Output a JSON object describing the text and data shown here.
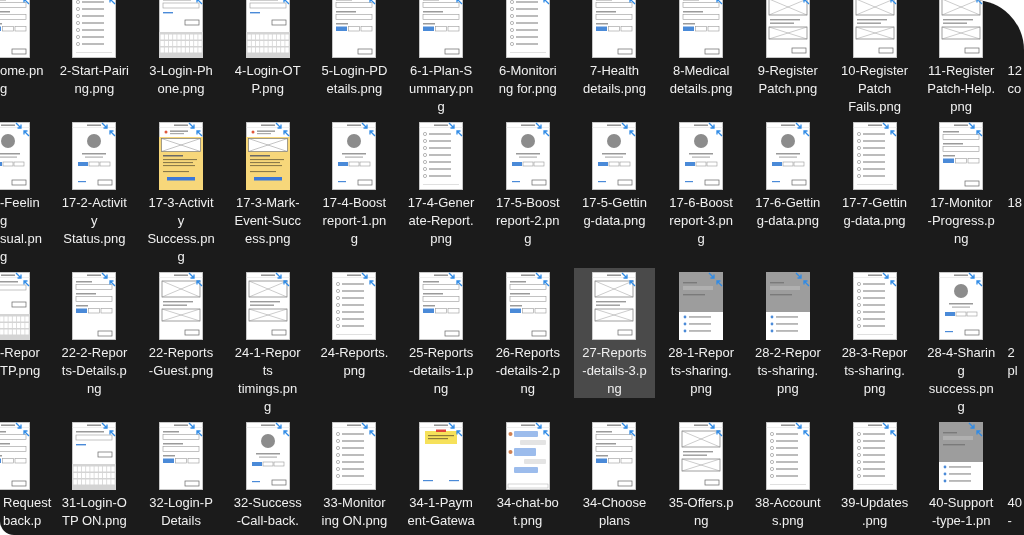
{
  "rows": [
    {
      "files": [
        {
          "label": [
            "ome.pn",
            "g"
          ],
          "selected": false,
          "kind": "form"
        },
        {
          "label": [
            "2-Start-Pairi",
            "ng.png"
          ],
          "selected": false,
          "kind": "list"
        },
        {
          "label": [
            "3-Login-Ph",
            "one.png"
          ],
          "selected": false,
          "kind": "keypad"
        },
        {
          "label": [
            "4-Login-OT",
            "P.png"
          ],
          "selected": false,
          "kind": "keypad"
        },
        {
          "label": [
            "5-Login-PD",
            "etails.png"
          ],
          "selected": false,
          "kind": "form"
        },
        {
          "label": [
            "6-1-Plan-S",
            "ummary.pn",
            "g"
          ],
          "selected": false,
          "kind": "form"
        },
        {
          "label": [
            "6-Monitori",
            "ng for.png"
          ],
          "selected": false,
          "kind": "list"
        },
        {
          "label": [
            "7-Health",
            "details.png"
          ],
          "selected": false,
          "kind": "form"
        },
        {
          "label": [
            "8-Medical",
            "details.png"
          ],
          "selected": false,
          "kind": "form"
        },
        {
          "label": [
            "9-Register",
            "Patch.png"
          ],
          "selected": false,
          "kind": "boxes"
        },
        {
          "label": [
            "10-Register",
            "Patch",
            "Fails.png"
          ],
          "selected": false,
          "kind": "boxes"
        },
        {
          "label": [
            "11-Register",
            "Patch-Help.",
            "png"
          ],
          "selected": false,
          "kind": "boxes"
        },
        {
          "label": [
            "12",
            "co"
          ],
          "selected": false
        }
      ]
    },
    {
      "files": [
        {
          "label": [
            "-Feelin",
            "g",
            "sual.pn",
            "g"
          ],
          "selected": false,
          "kind": "icon"
        },
        {
          "label": [
            "17-2-Activit",
            "y",
            "Status.png"
          ],
          "selected": false,
          "kind": "icon"
        },
        {
          "label": [
            "17-3-Activit",
            "y",
            "Success.pn",
            "g"
          ],
          "selected": false,
          "kind": "yellow"
        },
        {
          "label": [
            "17-3-Mark-",
            "Event-Succ",
            "ess.png"
          ],
          "selected": false,
          "kind": "yellow"
        },
        {
          "label": [
            "17-4-Boost",
            "report-1.pn",
            "g"
          ],
          "selected": false,
          "kind": "icon"
        },
        {
          "label": [
            "17-4-Gener",
            "ate-Report.",
            "png"
          ],
          "selected": false,
          "kind": "list"
        },
        {
          "label": [
            "17-5-Boost",
            "report-2.pn",
            "g"
          ],
          "selected": false,
          "kind": "icon"
        },
        {
          "label": [
            "17-5-Gettin",
            "g-data.png"
          ],
          "selected": false,
          "kind": "icon"
        },
        {
          "label": [
            "17-6-Boost",
            "report-3.pn",
            "g"
          ],
          "selected": false,
          "kind": "icon"
        },
        {
          "label": [
            "17-6-Gettin",
            "g-data.png"
          ],
          "selected": false,
          "kind": "icon"
        },
        {
          "label": [
            "17-7-Gettin",
            "g-data.png"
          ],
          "selected": false,
          "kind": "list"
        },
        {
          "label": [
            "17-Monitor",
            "-Progress.p",
            "ng"
          ],
          "selected": false,
          "kind": "form"
        },
        {
          "label": [
            "18"
          ],
          "selected": false
        }
      ]
    },
    {
      "files": [
        {
          "label": [
            "-Repor",
            "TP.png"
          ],
          "selected": false,
          "kind": "keypad"
        },
        {
          "label": [
            "22-2-Repor",
            "ts-Details.p",
            "ng"
          ],
          "selected": false,
          "kind": "form"
        },
        {
          "label": [
            "22-Reports",
            "-Guest.png"
          ],
          "selected": false,
          "kind": "boxes"
        },
        {
          "label": [
            "24-1-Repor",
            "ts",
            "timings.pn",
            "g"
          ],
          "selected": false,
          "kind": "boxes"
        },
        {
          "label": [
            "24-Reports.",
            "png"
          ],
          "selected": false,
          "kind": "list"
        },
        {
          "label": [
            "25-Reports",
            "-details-1.p",
            "ng"
          ],
          "selected": false,
          "kind": "form"
        },
        {
          "label": [
            "26-Reports",
            "-details-2.p",
            "ng"
          ],
          "selected": false,
          "kind": "form"
        },
        {
          "label": [
            "27-Reports",
            "-details-3.p",
            "ng"
          ],
          "selected": true,
          "kind": "boxes"
        },
        {
          "label": [
            "28-1-Repor",
            "ts-sharing.",
            "png"
          ],
          "selected": false,
          "kind": "dimmed"
        },
        {
          "label": [
            "28-2-Repor",
            "ts-sharing.",
            "png"
          ],
          "selected": false,
          "kind": "dimmed"
        },
        {
          "label": [
            "28-3-Repor",
            "ts-sharing.",
            "png"
          ],
          "selected": false,
          "kind": "list"
        },
        {
          "label": [
            "28-4-Sharin",
            "g",
            "success.pn",
            "g"
          ],
          "selected": false,
          "kind": "icon"
        },
        {
          "label": [
            "2",
            "pl"
          ],
          "selected": false
        }
      ]
    },
    {
      "files": [
        {
          "label": [
            "Request",
            "back.p"
          ],
          "selected": false,
          "kind": "form"
        },
        {
          "label": [
            "31-Login-O",
            "TP ON.png"
          ],
          "selected": false,
          "kind": "keypad"
        },
        {
          "label": [
            "32-Login-P",
            "Details"
          ],
          "selected": false,
          "kind": "form"
        },
        {
          "label": [
            "32-Success",
            "-Call-back."
          ],
          "selected": false,
          "kind": "icon"
        },
        {
          "label": [
            "33-Monitor",
            "ing ON.png"
          ],
          "selected": false,
          "kind": "list"
        },
        {
          "label": [
            "34-1-Paym",
            "ent-Gatewa"
          ],
          "selected": false,
          "kind": "note"
        },
        {
          "label": [
            "34-chat-bo",
            "t.png"
          ],
          "selected": false,
          "kind": "chat"
        },
        {
          "label": [
            "34-Choose",
            "plans"
          ],
          "selected": false,
          "kind": "form"
        },
        {
          "label": [
            "35-Offers.p",
            "ng"
          ],
          "selected": false,
          "kind": "boxes"
        },
        {
          "label": [
            "38-Account",
            "s.png"
          ],
          "selected": false,
          "kind": "list"
        },
        {
          "label": [
            "39-Updates",
            ".png"
          ],
          "selected": false,
          "kind": "list"
        },
        {
          "label": [
            "40-Support",
            "-type-1.pn"
          ],
          "selected": false,
          "kind": "dimmed"
        },
        {
          "label": [
            "40",
            "-"
          ],
          "selected": false
        }
      ]
    }
  ]
}
